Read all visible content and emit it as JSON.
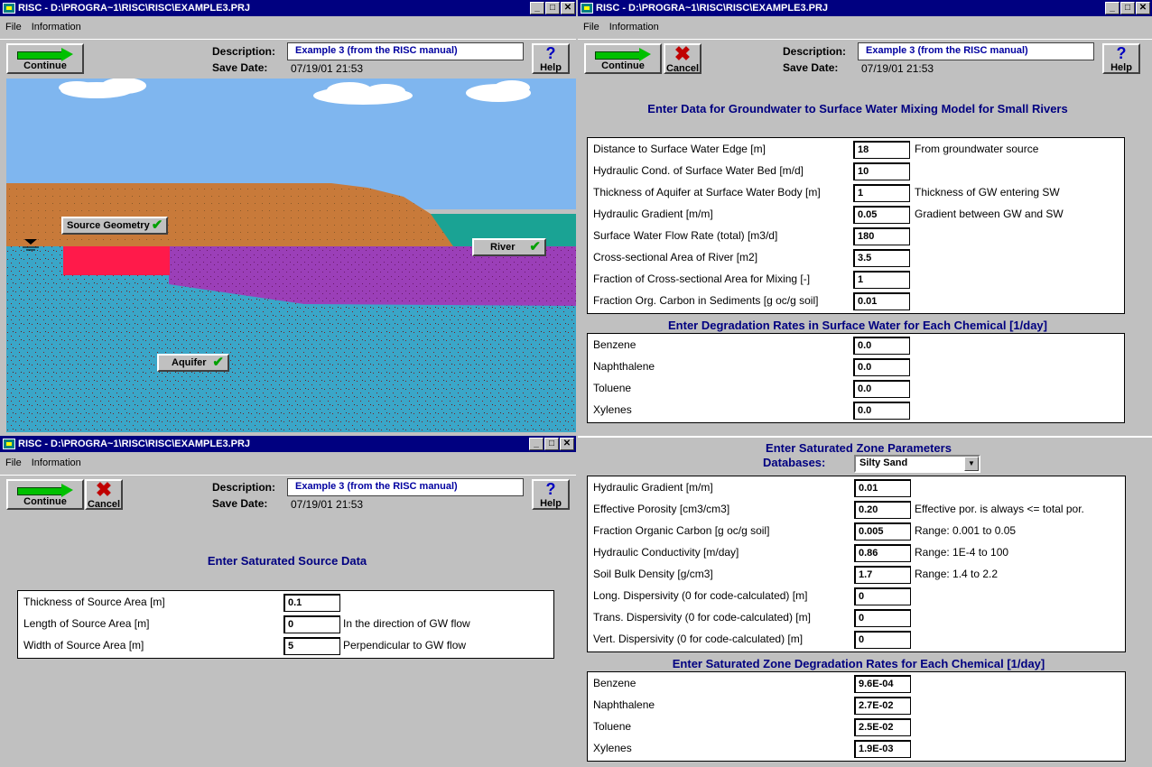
{
  "common": {
    "menu_file": "File",
    "menu_info": "Information",
    "continue": "Continue",
    "cancel": "Cancel",
    "help": "Help",
    "desc_label": "Description:",
    "save_label": "Save Date:",
    "minimize": "_",
    "maximize": "□",
    "close": "✕",
    "check": "✔",
    "x": "✖",
    "q": "?"
  },
  "windows": {
    "tl": {
      "title": "RISC - D:\\PROGRA~1\\RISC\\RISC\\EXAMPLE3.PRJ",
      "description": "Example 3 (from the RISC manual)",
      "save_date": "07/19/01  21:53"
    },
    "tr": {
      "title": "RISC - D:\\PROGRA~1\\RISC\\RISC\\EXAMPLE3.PRJ",
      "description": "Example 3 (from the RISC manual)",
      "save_date": "07/19/01  21:53"
    },
    "bl": {
      "title": "RISC - D:\\PROGRA~1\\RISC\\RISC\\EXAMPLE3.PRJ",
      "description": "Example 3 (from the RISC manual)",
      "save_date": "07/19/01  21:53"
    }
  },
  "scene": {
    "source_geometry": "Source Geometry",
    "river": "River",
    "aquifer": "Aquifer"
  },
  "mixing": {
    "heading": "Enter Data for Groundwater to Surface Water Mixing Model for Small Rivers",
    "rows": [
      {
        "label": "Distance to Surface Water Edge [m]",
        "value": "18",
        "note": "From groundwater source"
      },
      {
        "label": "Hydraulic Cond. of Surface Water Bed [m/d]",
        "value": "10",
        "note": ""
      },
      {
        "label": "Thickness of Aquifer at Surface Water Body [m]",
        "value": "1",
        "note": "Thickness of GW entering SW"
      },
      {
        "label": "Hydraulic Gradient [m/m]",
        "value": "0.05",
        "note": "Gradient between GW and SW"
      },
      {
        "label": "Surface Water Flow Rate (total) [m3/d]",
        "value": "180",
        "note": ""
      },
      {
        "label": "Cross-sectional Area of River [m2]",
        "value": "3.5",
        "note": ""
      },
      {
        "label": "Fraction of Cross-sectional Area for Mixing [-]",
        "value": "1",
        "note": ""
      },
      {
        "label": "Fraction Org. Carbon in Sediments [g oc/g soil]",
        "value": "0.01",
        "note": ""
      }
    ],
    "deg_heading": "Enter Degradation Rates in Surface Water for Each Chemical [1/day]",
    "deg_rows": [
      {
        "label": "Benzene",
        "value": "0.0"
      },
      {
        "label": "Naphthalene",
        "value": "0.0"
      },
      {
        "label": "Toluene",
        "value": "0.0"
      },
      {
        "label": "Xylenes",
        "value": "0.0"
      }
    ]
  },
  "source": {
    "heading": "Enter Saturated Source Data",
    "rows": [
      {
        "label": "Thickness of Source Area [m]",
        "value": "0.1",
        "note": ""
      },
      {
        "label": "Length of Source Area [m]",
        "value": "0",
        "note": "In the direction of GW flow"
      },
      {
        "label": "Width of Source Area [m]",
        "value": "5",
        "note": "Perpendicular to GW flow"
      }
    ]
  },
  "saturated": {
    "heading": "Enter Saturated Zone Parameters",
    "db_label": "Databases:",
    "db_value": "Silty Sand",
    "db_arrow": "▼",
    "rows": [
      {
        "label": "Hydraulic Gradient [m/m]",
        "value": "0.01",
        "note": ""
      },
      {
        "label": "Effective Porosity [cm3/cm3]",
        "value": "0.20",
        "note": "Effective por. is always <= total por."
      },
      {
        "label": "Fraction Organic Carbon [g oc/g soil]",
        "value": "0.005",
        "note": "Range: 0.001 to 0.05"
      },
      {
        "label": "Hydraulic Conductivity [m/day]",
        "value": "0.86",
        "note": "Range:  1E-4 to 100"
      },
      {
        "label": "Soil Bulk Density [g/cm3]",
        "value": "1.7",
        "note": "Range:  1.4 to 2.2"
      },
      {
        "label": "Long. Dispersivity (0 for code-calculated) [m]",
        "value": "0",
        "note": ""
      },
      {
        "label": "Trans. Dispersivity (0 for code-calculated) [m]",
        "value": "0",
        "note": ""
      },
      {
        "label": "Vert. Dispersivity (0 for code-calculated) [m]",
        "value": "0",
        "note": ""
      }
    ],
    "deg_heading": "Enter Saturated Zone Degradation Rates for Each Chemical [1/day]",
    "deg_rows": [
      {
        "label": "Benzene",
        "value": "9.6E-04"
      },
      {
        "label": "Naphthalene",
        "value": "2.7E-02"
      },
      {
        "label": "Toluene",
        "value": "2.5E-02"
      },
      {
        "label": "Xylenes",
        "value": "1.9E-03"
      }
    ]
  }
}
